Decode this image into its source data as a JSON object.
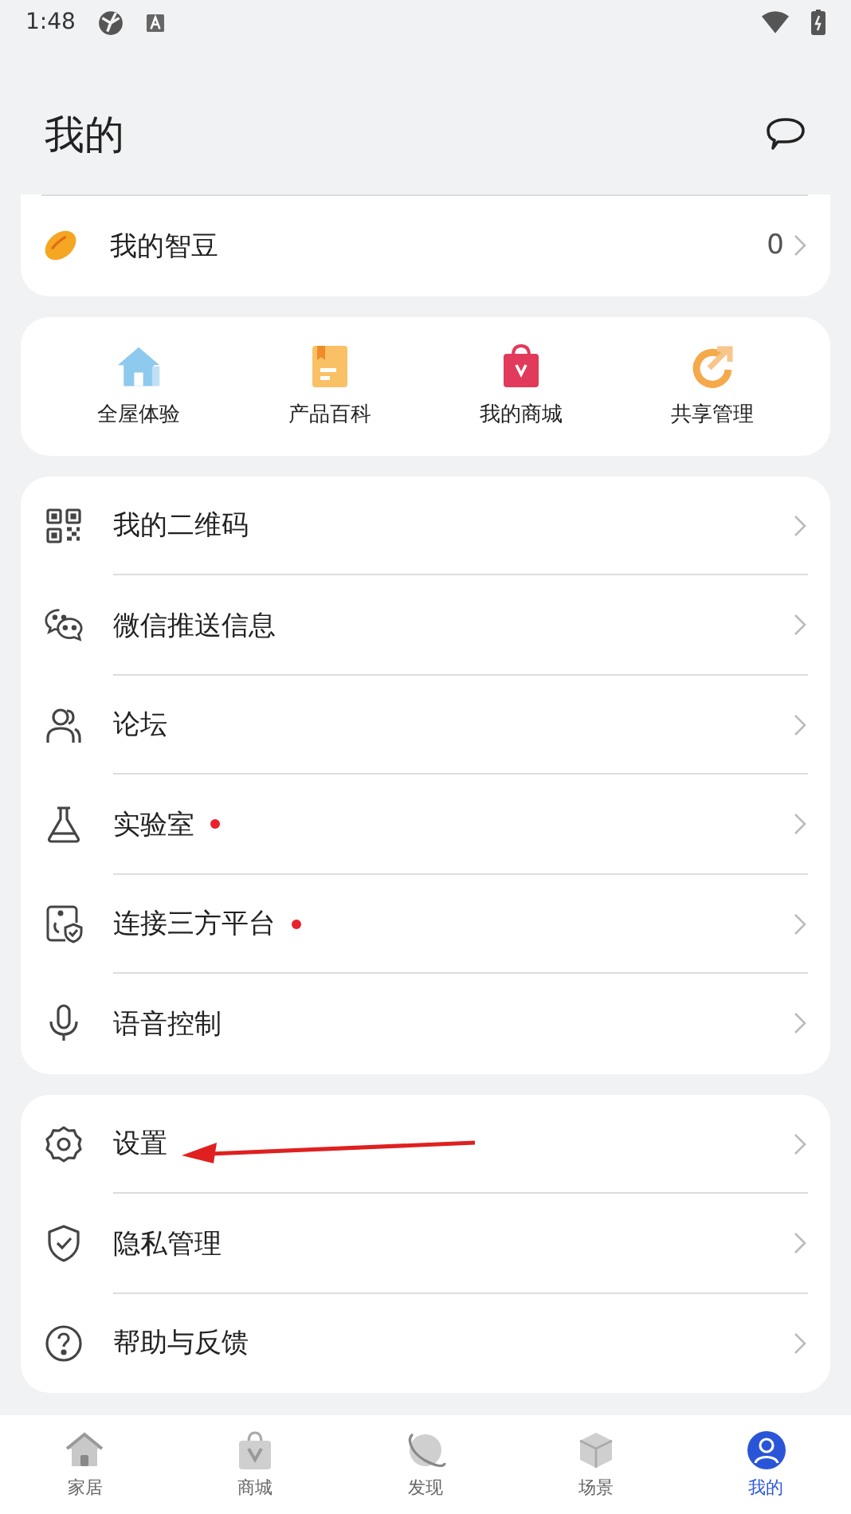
{
  "status_bar": {
    "time": "1:48"
  },
  "header": {
    "title": "我的"
  },
  "beans": {
    "label": "我的智豆",
    "value": "0"
  },
  "shortcuts": [
    {
      "label": "全屋体验",
      "kind": "house"
    },
    {
      "label": "产品百科",
      "kind": "book"
    },
    {
      "label": "我的商城",
      "kind": "bag"
    },
    {
      "label": "共享管理",
      "kind": "share"
    }
  ],
  "menu_groups": [
    [
      {
        "label": "我的二维码",
        "kind": "qr",
        "dot": false
      },
      {
        "label": "微信推送信息",
        "kind": "chat",
        "dot": false
      },
      {
        "label": "论坛",
        "kind": "people",
        "dot": false
      },
      {
        "label": "实验室",
        "kind": "flask",
        "dot": true
      },
      {
        "label": "连接三方平台",
        "kind": "link",
        "dot": true
      },
      {
        "label": "语音控制",
        "kind": "mic",
        "dot": false
      }
    ],
    [
      {
        "label": "设置",
        "kind": "gear",
        "dot": false
      },
      {
        "label": "隐私管理",
        "kind": "shield",
        "dot": false
      },
      {
        "label": "帮助与反馈",
        "kind": "help",
        "dot": false
      }
    ]
  ],
  "bottom_nav": [
    {
      "label": "家居",
      "kind": "home",
      "selected": false
    },
    {
      "label": "商城",
      "kind": "bag",
      "selected": false
    },
    {
      "label": "发现",
      "kind": "planet",
      "selected": false
    },
    {
      "label": "场景",
      "kind": "cube",
      "selected": false
    },
    {
      "label": "我的",
      "kind": "person",
      "selected": true
    }
  ]
}
